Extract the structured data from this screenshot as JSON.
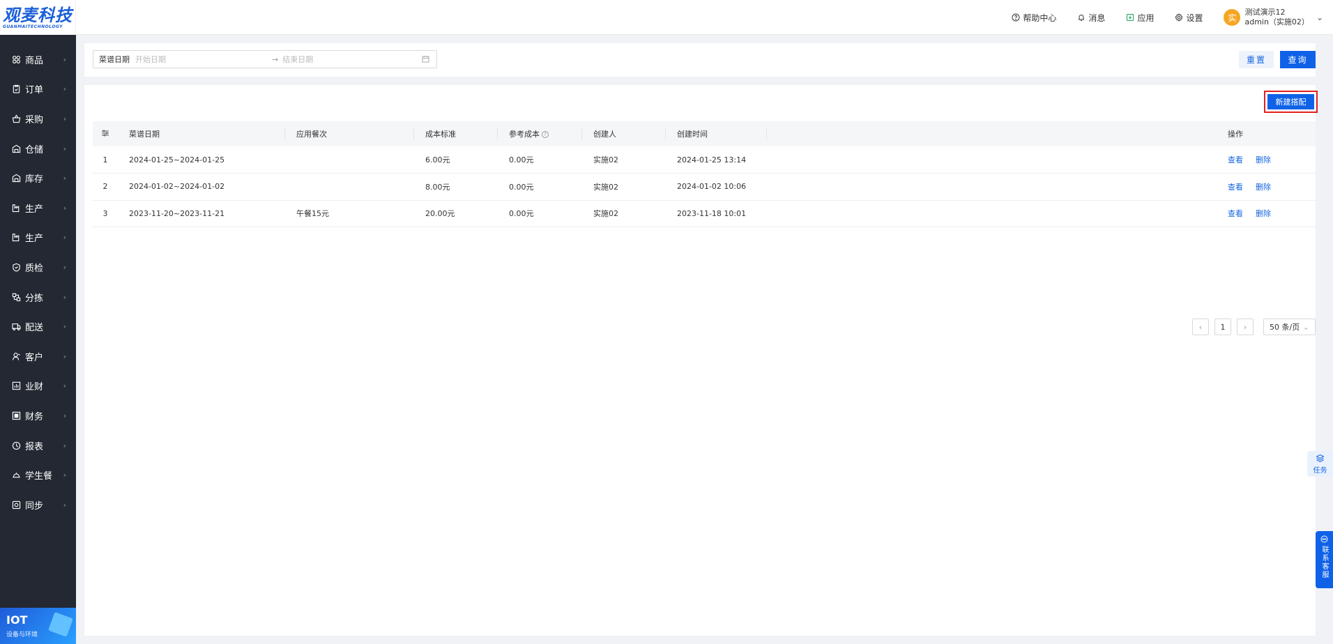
{
  "brand": {
    "name": "观麦科技",
    "sub": "GUANMAITECHNOLOGY"
  },
  "sidebar": {
    "items": [
      {
        "label": "商品",
        "icon": "grid-icon"
      },
      {
        "label": "订单",
        "icon": "clipboard-icon"
      },
      {
        "label": "采购",
        "icon": "basket-icon"
      },
      {
        "label": "仓储",
        "icon": "warehouse-icon"
      },
      {
        "label": "库存",
        "icon": "warehouse-icon"
      },
      {
        "label": "生产",
        "icon": "factory-icon"
      },
      {
        "label": "生产",
        "icon": "factory-icon"
      },
      {
        "label": "质检",
        "icon": "shield-icon"
      },
      {
        "label": "分拣",
        "icon": "sort-icon"
      },
      {
        "label": "配送",
        "icon": "truck-icon"
      },
      {
        "label": "客户",
        "icon": "user-icon"
      },
      {
        "label": "业财",
        "icon": "chart-icon"
      },
      {
        "label": "财务",
        "icon": "ledger-icon"
      },
      {
        "label": "报表",
        "icon": "clock-icon"
      },
      {
        "label": "学生餐",
        "icon": "dish-icon"
      },
      {
        "label": "同步",
        "icon": "sync-icon"
      }
    ],
    "iot": {
      "title": "IOT",
      "sub": "设备与环境"
    }
  },
  "header": {
    "help": "帮助中心",
    "message": "消息",
    "apps": "应用",
    "settings": "设置",
    "user": {
      "avatar": "实",
      "name": "测试演示12",
      "account": "admin（实施02）"
    }
  },
  "filter": {
    "label": "菜谱日期",
    "start_placeholder": "开始日期",
    "arrow": "→",
    "end_placeholder": "结束日期",
    "reset": "重置",
    "query": "查询"
  },
  "table": {
    "new_button": "新建搭配",
    "columns": [
      "菜谱日期",
      "应用餐次",
      "成本标准",
      "参考成本",
      "创建人",
      "创建时间",
      "操作"
    ],
    "rows": [
      {
        "idx": "1",
        "date": "2024-01-25~2024-01-25",
        "meal": "",
        "standard": "6.00元",
        "ref": "0.00元",
        "creator": "实施02",
        "created": "2024-01-25 13:14"
      },
      {
        "idx": "2",
        "date": "2024-01-02~2024-01-02",
        "meal": "",
        "standard": "8.00元",
        "ref": "0.00元",
        "creator": "实施02",
        "created": "2024-01-02 10:06"
      },
      {
        "idx": "3",
        "date": "2023-11-20~2023-11-21",
        "meal": "午餐15元",
        "standard": "20.00元",
        "ref": "0.00元",
        "creator": "实施02",
        "created": "2023-11-18 10:01"
      }
    ],
    "actions": {
      "view": "查看",
      "delete": "删除"
    }
  },
  "pager": {
    "prev": "‹",
    "page": "1",
    "next": "›",
    "size": "50 条/页"
  },
  "float": {
    "task": "任务",
    "contact": "联系客服"
  },
  "colors": {
    "primary": "#0f62e8",
    "sidebar": "#232832",
    "highlight": "#e02020"
  }
}
